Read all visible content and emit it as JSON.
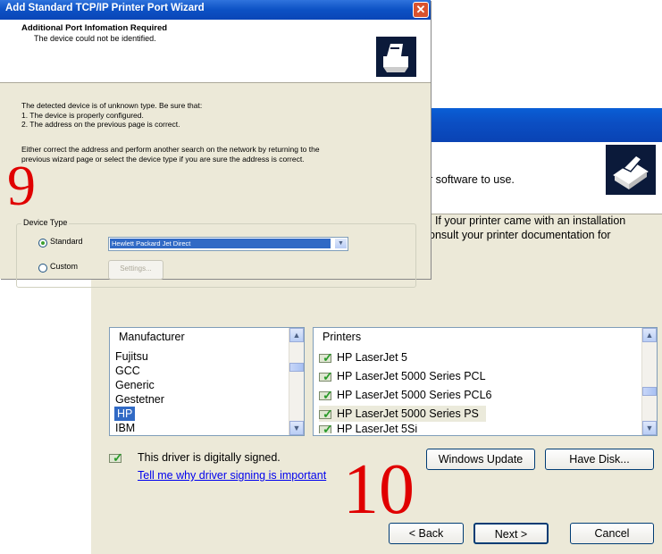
{
  "back_window": {
    "header_text": "r software to use.",
    "body_line1": ". If your printer came with an installation",
    "body_line2": "onsult your printer documentation for",
    "manufacturer": {
      "header": "Manufacturer",
      "items": [
        "Fujitsu",
        "GCC",
        "Generic",
        "Gestetner",
        "HP",
        "IBM"
      ],
      "selected": "HP"
    },
    "printers": {
      "header": "Printers",
      "items": [
        "HP LaserJet 5",
        "HP LaserJet 5000 Series PCL",
        "HP LaserJet 5000 Series PCL6",
        "HP LaserJet 5000 Series PS",
        "HP LaserJet 5Si"
      ],
      "selected": "HP LaserJet 5000 Series PS"
    },
    "signed_text": "This driver is digitally signed.",
    "signing_link": "Tell me why driver signing is important",
    "windows_update_label": "Windows Update",
    "have_disk_label": "Have Disk...",
    "back_label": "< Back",
    "next_label": "Next >",
    "cancel_label": "Cancel"
  },
  "front_window": {
    "title": "Add Standard TCP/IP Printer Port Wizard",
    "close_glyph": "✕",
    "heading": "Additional Port Infomation Required",
    "subheading": "The device could not be identified.",
    "para1": [
      "The detected device is of unknown type.  Be sure that:",
      "1. The device is properly configured.",
      "2. The address on the previous page is correct."
    ],
    "para2": [
      "Either correct the address and perform another search on the network by returning to the",
      "previous wizard page or select the device type if you are sure the address is correct."
    ],
    "device_type_label": "Device Type",
    "standard_label": "Standard",
    "custom_label": "Custom",
    "standard_value": "Hewlett Packard Jet Direct",
    "settings_label": "Settings..."
  },
  "annotations": {
    "step9": "9",
    "step10": "10"
  }
}
